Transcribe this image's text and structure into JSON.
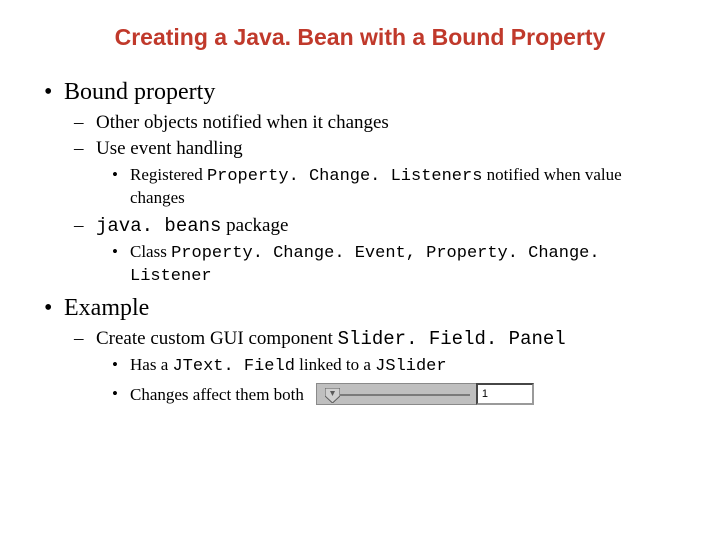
{
  "title": "Creating a Java. Bean with a Bound Property",
  "bullets": {
    "bound_property": "Bound property",
    "sub1": "Other objects notified when it changes",
    "sub2": "Use event handling",
    "reg1_pre": "Registered ",
    "reg1_code": "Property. Change. Listeners",
    "reg1_post": " notified when value changes",
    "pkg_code": "java. beans",
    "pkg_post": " package",
    "cls_pre": "Class ",
    "cls_code": "Property. Change. Event, Property. Change. Listener",
    "example": "Example",
    "create_pre": "Create custom GUI component ",
    "create_code": "Slider. Field. Panel",
    "has_pre": "Has a ",
    "has_code1": "JText. Field",
    "has_mid": " linked to a ",
    "has_code2": "JSlider",
    "changes": "Changes affect them both"
  },
  "widget": {
    "value": "1"
  }
}
